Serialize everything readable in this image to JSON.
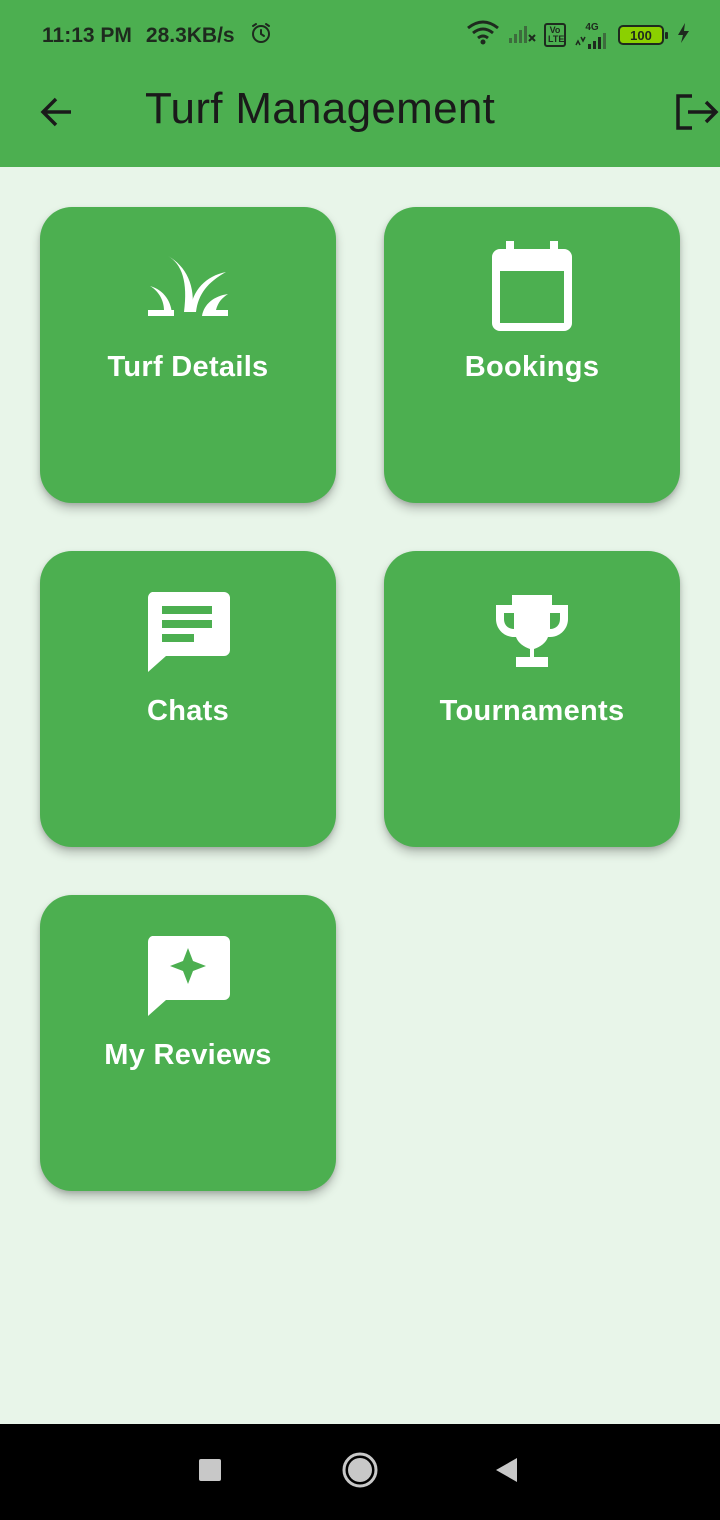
{
  "status_bar": {
    "time": "11:13 PM",
    "speed": "28.3KB/s",
    "volte": "Vo LTE",
    "network": "4G",
    "battery": "100",
    "icons": [
      "alarm-icon",
      "wifi-icon",
      "signal-icon",
      "signal-4g-icon",
      "charging-icon"
    ]
  },
  "app_bar": {
    "title": "Turf Management",
    "back_icon": "arrow-back-icon",
    "logout_icon": "logout-icon"
  },
  "tiles": [
    {
      "label": "Turf Details",
      "icon": "grass-icon"
    },
    {
      "label": "Bookings",
      "icon": "calendar-icon"
    },
    {
      "label": "Chats",
      "icon": "chat-icon"
    },
    {
      "label": "Tournaments",
      "icon": "trophy-icon"
    },
    {
      "label": "My Reviews",
      "icon": "reviews-icon"
    }
  ],
  "nav_bar": {
    "icons": [
      "recents-square-icon",
      "home-circle-icon",
      "back-triangle-icon"
    ]
  },
  "colors": {
    "primary": "#4caf50",
    "background": "#e8f5e9",
    "tile_text": "#ffffff",
    "title_text": "#1a1a1a",
    "nav_bar": "#000000"
  }
}
